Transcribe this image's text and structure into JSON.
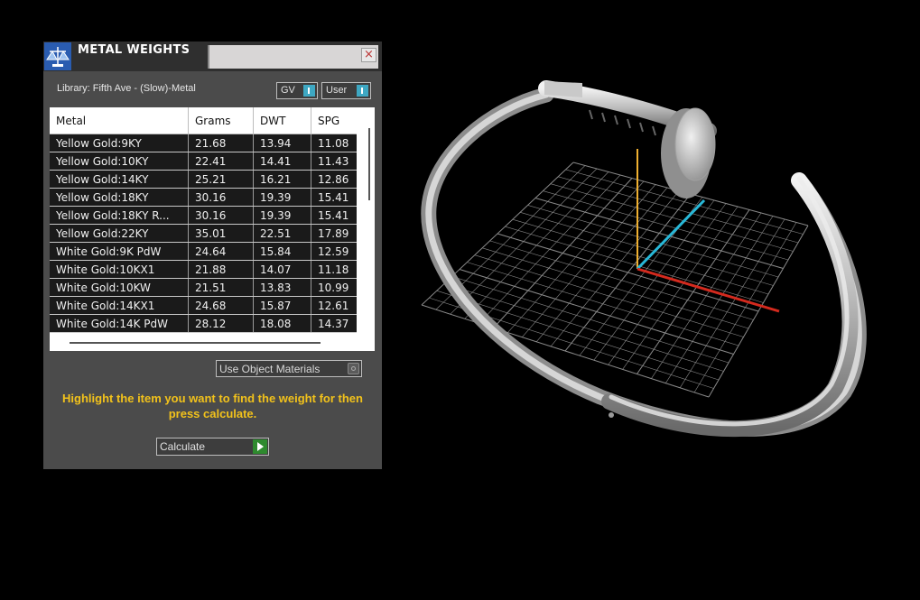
{
  "panel": {
    "title": "METAL WEIGHTS",
    "close_label": "×",
    "library_label": "Library: Fifth Ave - (Slow)-Metal",
    "toggles": {
      "gv": "GV",
      "user": "User"
    },
    "table": {
      "headers": [
        "Metal",
        "Grams",
        "DWT",
        "SPG"
      ],
      "rows": [
        [
          "Yellow Gold:9KY",
          "21.68",
          "13.94",
          "11.08"
        ],
        [
          "Yellow Gold:10KY",
          "22.41",
          "14.41",
          "11.43"
        ],
        [
          "Yellow Gold:14KY",
          "25.21",
          "16.21",
          "12.86"
        ],
        [
          "Yellow Gold:18KY",
          "30.16",
          "19.39",
          "15.41"
        ],
        [
          "Yellow Gold:18KY R...",
          "30.16",
          "19.39",
          "15.41"
        ],
        [
          "Yellow Gold:22KY",
          "35.01",
          "22.51",
          "17.89"
        ],
        [
          "White Gold:9K PdW",
          "24.64",
          "15.84",
          "12.59"
        ],
        [
          "White Gold:10KX1",
          "21.88",
          "14.07",
          "11.18"
        ],
        [
          "White Gold:10KW",
          "21.51",
          "13.83",
          "10.99"
        ],
        [
          "White Gold:14KX1",
          "24.68",
          "15.87",
          "12.61"
        ],
        [
          "White Gold:14K PdW",
          "28.12",
          "18.08",
          "14.37"
        ]
      ]
    },
    "use_object_materials": "Use Object Materials",
    "instructions": "Highlight the item you want to find the weight for then press calculate.",
    "calculate_label": "Calculate"
  },
  "viewport": {
    "object": "nail-bangle-ring",
    "axis_colors": {
      "x": "#d42a1e",
      "y": "#28b8d8",
      "z": "#f0b030"
    },
    "grid_color": "#8a8a8a"
  }
}
